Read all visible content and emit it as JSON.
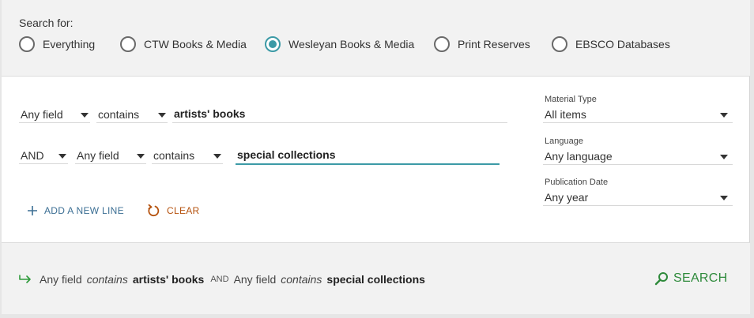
{
  "scope": {
    "label": "Search for:",
    "options": [
      {
        "label": "Everything",
        "selected": false
      },
      {
        "label": "CTW Books & Media",
        "selected": false
      },
      {
        "label": "Wesleyan Books & Media",
        "selected": true
      },
      {
        "label": "Print Reserves",
        "selected": false
      },
      {
        "label": "EBSCO Databases",
        "selected": false
      }
    ]
  },
  "query": {
    "rows": [
      {
        "operator": "",
        "field": "Any field",
        "condition": "contains",
        "value": "artists' books"
      },
      {
        "operator": "AND",
        "field": "Any field",
        "condition": "contains",
        "value": "special collections"
      }
    ]
  },
  "actions": {
    "add_line": "ADD A NEW LINE",
    "clear": "CLEAR"
  },
  "facets": {
    "material_type": {
      "label": "Material Type",
      "value": "All items"
    },
    "language": {
      "label": "Language",
      "value": "Any language"
    },
    "publication_date": {
      "label": "Publication Date",
      "value": "Any year"
    }
  },
  "summary": {
    "field1": "Any field",
    "cond1": "contains",
    "value1": "artists' books",
    "operator": "AND",
    "field2": "Any field",
    "cond2": "contains",
    "value2": "special collections"
  },
  "search_button": "SEARCH",
  "colors": {
    "accent_teal": "#3c9aa6",
    "search_green": "#2e8a3b",
    "clear_orange": "#b5520e",
    "add_blue": "#3c6f94"
  }
}
